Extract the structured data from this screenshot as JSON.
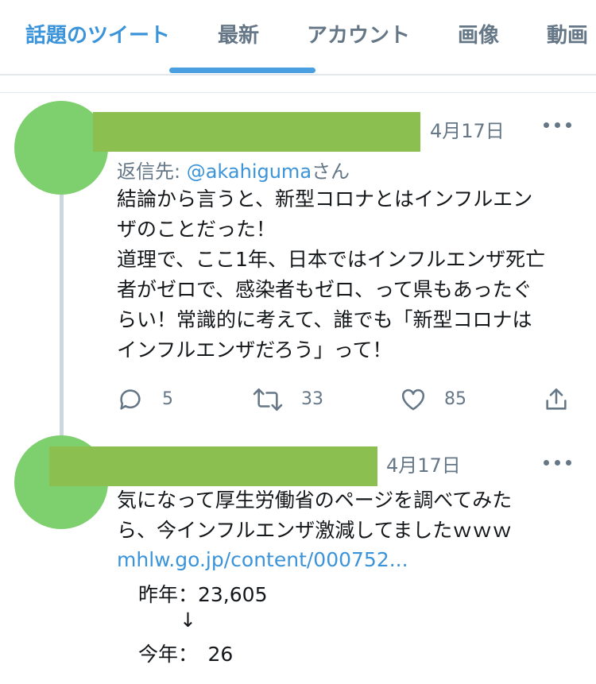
{
  "tabs": [
    {
      "label": "話題のツイート",
      "active": true
    },
    {
      "label": "最新",
      "active": false
    },
    {
      "label": "アカウント",
      "active": false
    },
    {
      "label": "画像",
      "active": false
    },
    {
      "label": "動画",
      "active": false
    }
  ],
  "tweets": [
    {
      "date": "4月17日",
      "reply_prefix": "返信先: ",
      "reply_handle": "@akahiguma",
      "reply_suffix": "さん",
      "text": "結論から言うと、新型コロナとはインフルエン\nザのことだった！\n道理で、ここ1年、日本ではインフルエンザ死亡\n者がゼロで、感染者もゼロ、って県もあったぐ\nらい！常識的に考えて、誰でも「新型コロナは\nインフルエンザだろう」って！",
      "reply_count": "5",
      "retweet_count": "33",
      "like_count": "85"
    },
    {
      "date": "4月17日",
      "text": "気になって厚生労働省のページを調べてみた\nら、今インフルエンザ激減してましたｗｗｗ",
      "link": "mhlw.go.jp/content/000752...",
      "stats_last_year": "昨年：23,605",
      "stats_arrow": "↓",
      "stats_this_year": "今年：　26"
    }
  ],
  "colors": {
    "accent": "#3b94d9",
    "avatar": "#7ecf6e",
    "redaction": "#8bbf4f",
    "muted": "#657786"
  },
  "icons": [
    "more-icon",
    "reply-icon",
    "retweet-icon",
    "like-icon",
    "share-icon"
  ]
}
